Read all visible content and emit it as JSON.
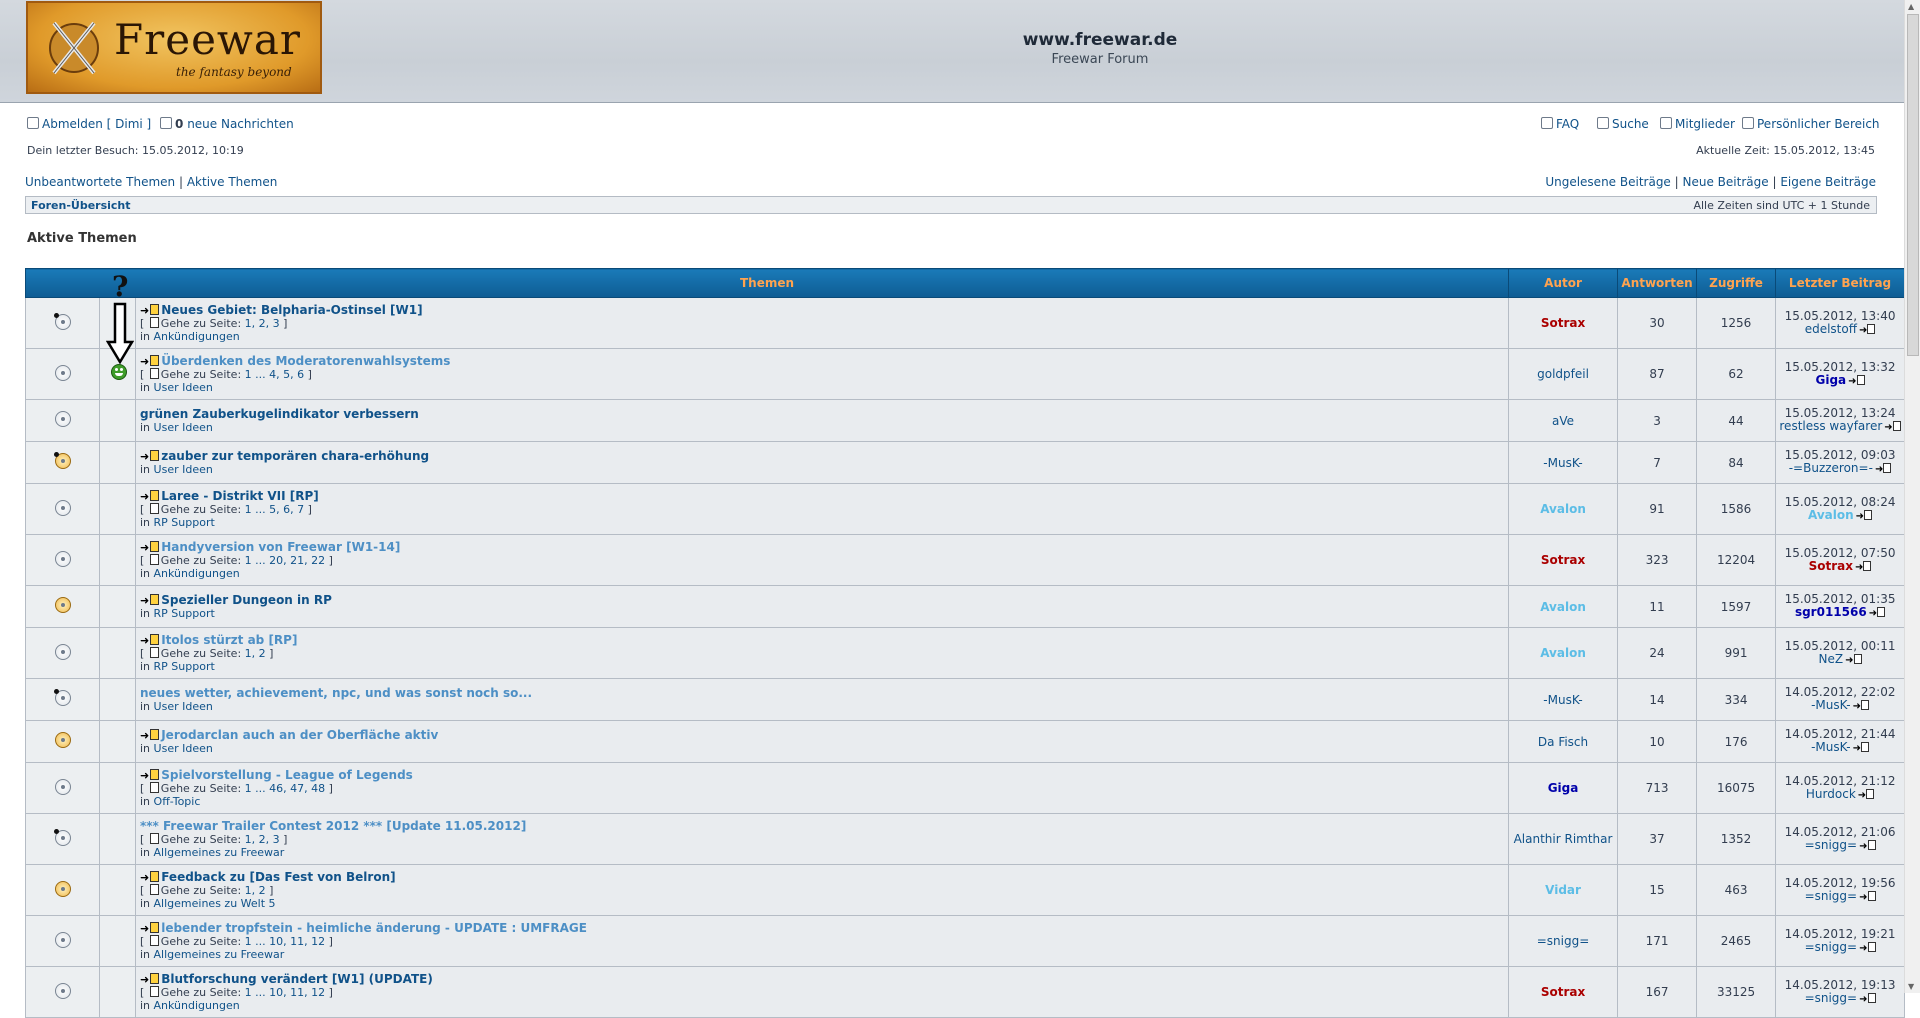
{
  "header": {
    "logo_title": "Freewar",
    "logo_tagline": "the fantasy beyond",
    "site_title": "www.freewar.de",
    "site_desc": "Freewar Forum"
  },
  "userbar": {
    "logout": "Abmelden [ Dimi ]",
    "messages_count": "0",
    "messages_label": "neue Nachrichten",
    "faq": "FAQ",
    "search": "Suche",
    "members": "Mitglieder",
    "ucp": "Persönlicher Bereich",
    "last_visit": "Dein letzter Besuch: 15.05.2012, 10:19",
    "current_time": "Aktuelle Zeit: 15.05.2012, 13:45"
  },
  "searchlinks": {
    "unanswered": "Unbeantwortete Themen",
    "active": "Aktive Themen",
    "unread": "Ungelesene Beiträge",
    "new": "Neue Beiträge",
    "own": "Eigene Beiträge",
    "sep": "|"
  },
  "breadcrumb": {
    "index": "Foren-Übersicht",
    "timezone": "Alle Zeiten sind UTC + 1 Stunde"
  },
  "page_title": "Aktive Themen",
  "annotation": {
    "question": "?"
  },
  "table": {
    "headers": {
      "topics": "Themen",
      "author": "Autor",
      "replies": "Antworten",
      "views": "Zugriffe",
      "last": "Letzter Beitrag"
    },
    "goto_label": "Gehe zu Seite:",
    "in_label": "in",
    "rows": [
      {
        "title": "Neues Gebiet: Belpharia-Ostinsel [W1]",
        "newpost": true,
        "read": false,
        "pages": "1, 2, 3",
        "forum": "Ankündigungen",
        "author": "Sotrax",
        "author_style": "red",
        "replies": "30",
        "views": "1256",
        "last_date": "15.05.2012, 13:40",
        "last_user": "edelstoff",
        "last_style": "norm",
        "folder": "mine"
      },
      {
        "title": "Überdenken des Moderatorenwahlsystems",
        "newpost": true,
        "read": true,
        "pages": "1 ... 4, 5, 6",
        "forum": "User Ideen",
        "author": "goldpfeil",
        "author_style": "norm",
        "replies": "87",
        "views": "62",
        "last_date": "15.05.2012, 13:32",
        "last_user": "Giga",
        "last_style": "blue",
        "folder": "plain"
      },
      {
        "title": "grünen Zauberkugelindikator verbessern",
        "newpost": false,
        "read": false,
        "pages": "",
        "forum": "User Ideen",
        "author": "aVe",
        "author_style": "norm",
        "replies": "3",
        "views": "44",
        "last_date": "15.05.2012, 13:24",
        "last_user": "restless wayfarer",
        "last_style": "norm",
        "folder": "plain"
      },
      {
        "title": "zauber zur temporären chara-erhöhung",
        "newpost": true,
        "read": false,
        "pages": "",
        "forum": "User Ideen",
        "author": "-MusK-",
        "author_style": "norm",
        "replies": "7",
        "views": "84",
        "last_date": "15.05.2012, 09:03",
        "last_user": "-=Buzzeron=-",
        "last_style": "norm",
        "folder": "newmine"
      },
      {
        "title": "Laree - Distrikt VII [RP]",
        "newpost": true,
        "read": false,
        "pages": "1 ... 5, 6, 7",
        "forum": "RP Support",
        "author": "Avalon",
        "author_style": "cyan",
        "replies": "91",
        "views": "1586",
        "last_date": "15.05.2012, 08:24",
        "last_user": "Avalon",
        "last_style": "cyan",
        "folder": "plain"
      },
      {
        "title": "Handyversion von Freewar [W1-14]",
        "newpost": true,
        "read": true,
        "pages": "1 ... 20, 21, 22",
        "forum": "Ankündigungen",
        "author": "Sotrax",
        "author_style": "red",
        "replies": "323",
        "views": "12204",
        "last_date": "15.05.2012, 07:50",
        "last_user": "Sotrax",
        "last_style": "red",
        "folder": "plain"
      },
      {
        "title": "Spezieller Dungeon in RP",
        "newpost": true,
        "read": false,
        "pages": "",
        "forum": "RP Support",
        "author": "Avalon",
        "author_style": "cyan",
        "replies": "11",
        "views": "1597",
        "last_date": "15.05.2012, 01:35",
        "last_user": "sgr011566",
        "last_style": "blue",
        "folder": "new"
      },
      {
        "title": "Itolos stürzt ab [RP]",
        "newpost": true,
        "read": true,
        "pages": "1, 2",
        "forum": "RP Support",
        "author": "Avalon",
        "author_style": "cyan",
        "replies": "24",
        "views": "991",
        "last_date": "15.05.2012, 00:11",
        "last_user": "NeZ",
        "last_style": "norm",
        "folder": "plain"
      },
      {
        "title": "neues wetter, achievement, npc, und was sonst noch so...",
        "newpost": false,
        "read": true,
        "pages": "",
        "forum": "User Ideen",
        "author": "-MusK-",
        "author_style": "norm",
        "replies": "14",
        "views": "334",
        "last_date": "14.05.2012, 22:02",
        "last_user": "-MusK-",
        "last_style": "norm",
        "folder": "mine"
      },
      {
        "title": "Jerodarclan auch an der Oberfläche aktiv",
        "newpost": true,
        "read": true,
        "pages": "",
        "forum": "User Ideen",
        "author": "Da Fisch",
        "author_style": "norm",
        "replies": "10",
        "views": "176",
        "last_date": "14.05.2012, 21:44",
        "last_user": "-MusK-",
        "last_style": "norm",
        "folder": "new"
      },
      {
        "title": "Spielvorstellung - League of Legends",
        "newpost": true,
        "read": true,
        "pages": "1 ... 46, 47, 48",
        "forum": "Off-Topic",
        "author": "Giga",
        "author_style": "blue",
        "replies": "713",
        "views": "16075",
        "last_date": "14.05.2012, 21:12",
        "last_user": "Hurdock",
        "last_style": "norm",
        "folder": "plain"
      },
      {
        "title": "*** Freewar Trailer Contest 2012 *** [Update 11.05.2012]",
        "newpost": false,
        "read": true,
        "pages": "1, 2, 3",
        "forum": "Allgemeines zu Freewar",
        "author": "Alanthir Rimthar",
        "author_style": "norm",
        "replies": "37",
        "views": "1352",
        "last_date": "14.05.2012, 21:06",
        "last_user": "=snigg=",
        "last_style": "norm",
        "folder": "mine"
      },
      {
        "title": "Feedback zu [Das Fest von Belron]",
        "newpost": true,
        "read": false,
        "pages": "1, 2",
        "forum": "Allgemeines zu Welt 5",
        "author": "Vidar",
        "author_style": "cyan",
        "replies": "15",
        "views": "463",
        "last_date": "14.05.2012, 19:56",
        "last_user": "=snigg=",
        "last_style": "norm",
        "folder": "new"
      },
      {
        "title": "lebender tropfstein - heimliche änderung - UPDATE : UMFRAGE",
        "newpost": true,
        "read": true,
        "pages": "1 ... 10, 11, 12",
        "forum": "Allgemeines zu Freewar",
        "author": "=snigg=",
        "author_style": "norm",
        "replies": "171",
        "views": "2465",
        "last_date": "14.05.2012, 19:21",
        "last_user": "=snigg=",
        "last_style": "norm",
        "folder": "plain"
      },
      {
        "title": "Blutforschung verändert [W1] (UPDATE)",
        "newpost": true,
        "read": false,
        "pages": "1 ... 10, 11, 12",
        "forum": "Ankündigungen",
        "author": "Sotrax",
        "author_style": "red",
        "replies": "167",
        "views": "33125",
        "last_date": "14.05.2012, 19:13",
        "last_user": "=snigg=",
        "last_style": "norm",
        "folder": "plain"
      }
    ]
  }
}
